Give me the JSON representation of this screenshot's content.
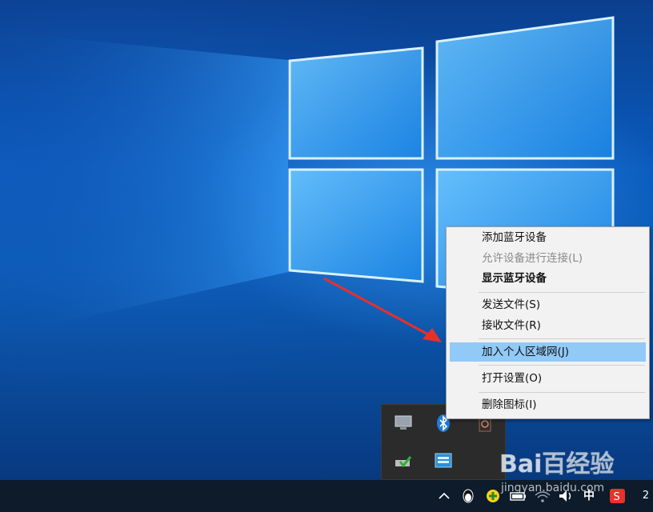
{
  "context_menu": {
    "items": [
      {
        "label": "添加蓝牙设备",
        "state": "normal"
      },
      {
        "label": "允许设备进行连接(L)",
        "state": "disabled"
      },
      {
        "label": "显示蓝牙设备",
        "state": "bold"
      },
      {
        "label": "发送文件(S)",
        "state": "normal"
      },
      {
        "label": "接收文件(R)",
        "state": "normal"
      },
      {
        "label": "加入个人区域网(J)",
        "state": "highlighted"
      },
      {
        "label": "打开设置(O)",
        "state": "normal"
      },
      {
        "label": "删除图标(I)",
        "state": "normal"
      }
    ],
    "highlight_color": "#91c9f7"
  },
  "tray_popup": {
    "icons": [
      "display-icon",
      "bluetooth-icon",
      "speaker-icon",
      "safe-remove-hardware-icon",
      "network-adapter-icon"
    ]
  },
  "taskbar": {
    "ime_label": "中",
    "clock_partial": "2",
    "icons": [
      "chevron-up-icon",
      "qq-penguin-icon",
      "add-green-icon",
      "battery-icon",
      "volume-icon",
      "sogou-ime-icon"
    ]
  },
  "watermark": {
    "brand": "Bai百经验",
    "url": "jingyan.baidu.com"
  },
  "colors": {
    "taskbar": "#0d1b2a",
    "menu_bg": "#f2f2f2",
    "arrow": "#e8302a"
  }
}
